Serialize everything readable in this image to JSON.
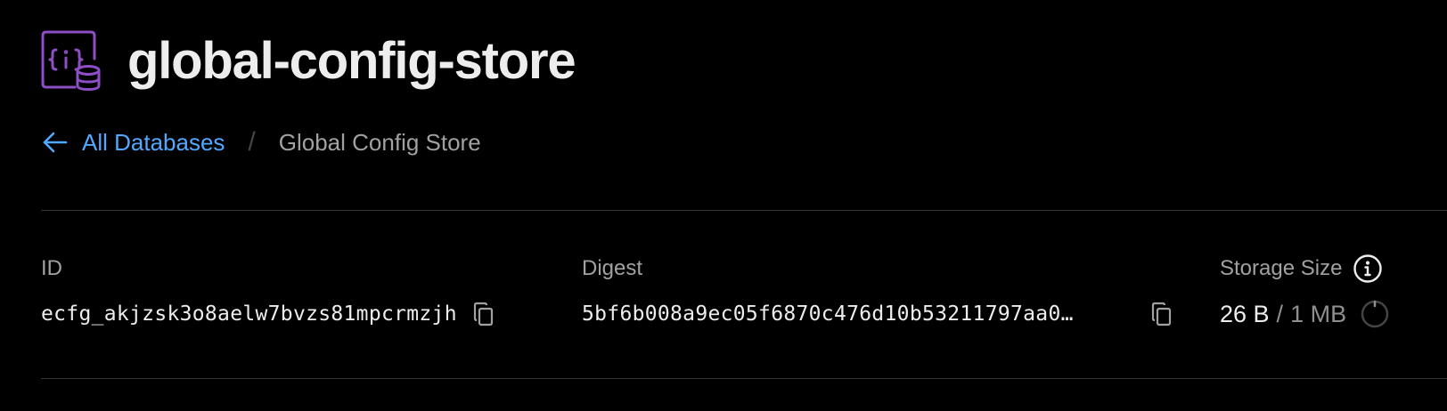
{
  "header": {
    "title": "global-config-store",
    "icon": "config-database-icon",
    "icon_color": "#8e4ec6"
  },
  "breadcrumb": {
    "back_label": "All Databases",
    "separator": "/",
    "current": "Global Config Store",
    "link_color": "#52a8ff"
  },
  "details": {
    "id": {
      "label": "ID",
      "value": "ecfg_akjzsk3o8aelw7bvzs81mpcrmzjh",
      "copy_icon": "copy-icon"
    },
    "digest": {
      "label": "Digest",
      "value": "5bf6b008a9ec05f6870c476d10b53211797aa0…",
      "copy_icon": "copy-icon"
    },
    "storage": {
      "label": "Storage Size",
      "used": "26 B",
      "separator": "/",
      "total": "1 MB",
      "info_icon": "info-icon",
      "usage_fraction": 2e-05
    }
  }
}
